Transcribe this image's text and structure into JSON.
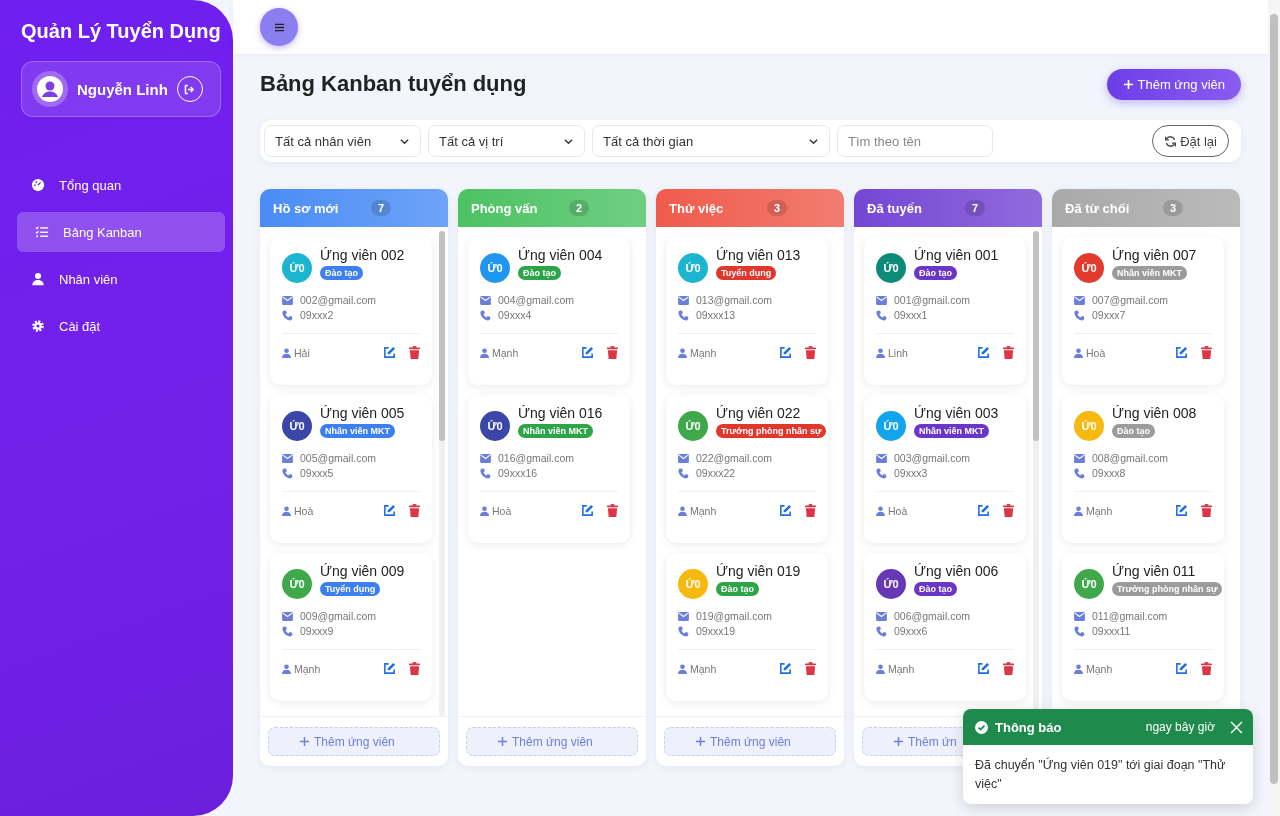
{
  "sidebar": {
    "title": "Quản Lý Tuyển Dụng",
    "user": {
      "name": "Nguyễn Linh"
    },
    "items": [
      {
        "label": "Tổng quan",
        "selected": false
      },
      {
        "label": "Bảng Kanban",
        "selected": true
      },
      {
        "label": "Nhân viên",
        "selected": false
      },
      {
        "label": "Cài đặt",
        "selected": false
      }
    ]
  },
  "page": {
    "title": "Bảng Kanban tuyển dụng",
    "add_button": "Thêm ứng viên"
  },
  "filters": {
    "selects": [
      "Tất cả nhân viên",
      "Tất cả vị trí",
      "Tất cả thời gian"
    ],
    "search": {
      "placeholder": "Tìm theo tên"
    },
    "reset_button": "Đặt lại"
  },
  "columns": [
    {
      "title": "Hồ sơ mới",
      "count": "7",
      "color": "#4a8cf5",
      "add_button": "Thêm ứng viên",
      "scrollbar": true,
      "cards": [
        {
          "avatar": {
            "text": "Ứ0",
            "color": "#1cb5cf"
          },
          "name": "Ứng viên 002",
          "tag": {
            "label": "Đào tạo",
            "color": "#3b7ff0"
          },
          "email": "002@gmail.com",
          "phone": "09xxx2",
          "owner": "Hải"
        },
        {
          "avatar": {
            "text": "Ứ0",
            "color": "#3a46a8"
          },
          "name": "Ứng viên 005",
          "tag": {
            "label": "Nhân viên MKT",
            "color": "#3b7ff0"
          },
          "email": "005@gmail.com",
          "phone": "09xxx5",
          "owner": "Hoà"
        },
        {
          "avatar": {
            "text": "Ứ0",
            "color": "#3ea84a"
          },
          "name": "Ứng viên 009",
          "tag": {
            "label": "Tuyển dụng",
            "color": "#3b7ff0"
          },
          "email": "009@gmail.com",
          "phone": "09xxx9",
          "owner": "Mạnh"
        }
      ]
    },
    {
      "title": "Phỏng vấn",
      "count": "2",
      "color": "#4cc263",
      "add_button": "Thêm ứng viên",
      "scrollbar": false,
      "cards": [
        {
          "avatar": {
            "text": "Ứ0",
            "color": "#2196f0"
          },
          "name": "Ứng viên 004",
          "tag": {
            "label": "Đào tạo",
            "color": "#2ea448"
          },
          "email": "004@gmail.com",
          "phone": "09xxx4",
          "owner": "Mạnh"
        },
        {
          "avatar": {
            "text": "Ứ0",
            "color": "#3a46a8"
          },
          "name": "Ứng viên 016",
          "tag": {
            "label": "Nhân viên MKT",
            "color": "#2ea448"
          },
          "email": "016@gmail.com",
          "phone": "09xxx16",
          "owner": "Hoà"
        }
      ]
    },
    {
      "title": "Thử việc",
      "count": "3",
      "color": "#ef5b4c",
      "add_button": "Thêm ứng viên",
      "scrollbar": false,
      "cards": [
        {
          "avatar": {
            "text": "Ứ0",
            "color": "#1cb5cf"
          },
          "name": "Ứng viên 013",
          "tag": {
            "label": "Tuyển dụng",
            "color": "#e0362c"
          },
          "email": "013@gmail.com",
          "phone": "09xxx13",
          "owner": "Mạnh"
        },
        {
          "avatar": {
            "text": "Ứ0",
            "color": "#3ea84a"
          },
          "name": "Ứng viên 022",
          "tag": {
            "label": "Trưởng phòng nhân sự",
            "color": "#e0362c"
          },
          "email": "022@gmail.com",
          "phone": "09xxx22",
          "owner": "Mạnh"
        },
        {
          "avatar": {
            "text": "Ứ0",
            "color": "#f6b90f"
          },
          "name": "Ứng viên 019",
          "tag": {
            "label": "Đào tạo",
            "color": "#2ea448"
          },
          "email": "019@gmail.com",
          "phone": "09xxx19",
          "owner": "Mạnh"
        }
      ]
    },
    {
      "title": "Đã tuyển",
      "count": "7",
      "color": "#7446d4",
      "add_button": "Thêm ứn",
      "scrollbar": true,
      "cards": [
        {
          "avatar": {
            "text": "Ứ0",
            "color": "#0e8a78"
          },
          "name": "Ứng viên 001",
          "tag": {
            "label": "Đào tạo",
            "color": "#6a35c8"
          },
          "email": "001@gmail.com",
          "phone": "09xxx1",
          "owner": "Linh"
        },
        {
          "avatar": {
            "text": "Ứ0",
            "color": "#12a5ec"
          },
          "name": "Ứng viên 003",
          "tag": {
            "label": "Nhân viên MKT",
            "color": "#6a35c8"
          },
          "email": "003@gmail.com",
          "phone": "09xxx3",
          "owner": "Hoà"
        },
        {
          "avatar": {
            "text": "Ứ0",
            "color": "#6738b5"
          },
          "name": "Ứng viên 006",
          "tag": {
            "label": "Đào tạo",
            "color": "#6a35c8"
          },
          "email": "006@gmail.com",
          "phone": "09xxx6",
          "owner": "Mạnh"
        }
      ]
    },
    {
      "title": "Đã từ chối",
      "count": "3",
      "color": "#a9a9a9",
      "scrollbar": false,
      "cards": [
        {
          "avatar": {
            "text": "Ứ0",
            "color": "#e33a2e"
          },
          "name": "Ứng viên 007",
          "tag": {
            "label": "Nhân viên MKT",
            "color": "#9b9b9b"
          },
          "email": "007@gmail.com",
          "phone": "09xxx7",
          "owner": "Hoà"
        },
        {
          "avatar": {
            "text": "Ứ0",
            "color": "#f6b90f"
          },
          "name": "Ứng viên 008",
          "tag": {
            "label": "Đào tạo",
            "color": "#9b9b9b"
          },
          "email": "008@gmail.com",
          "phone": "09xxx8",
          "owner": "Mạnh"
        },
        {
          "avatar": {
            "text": "Ứ0",
            "color": "#3ea84a"
          },
          "name": "Ứng viên 011",
          "tag": {
            "label": "Trưởng phòng nhân sự",
            "color": "#9b9b9b"
          },
          "email": "011@gmail.com",
          "phone": "09xxx11",
          "owner": "Mạnh"
        }
      ]
    }
  ],
  "toast": {
    "title": "Thông báo",
    "time": "ngay bây giờ",
    "message": "Đã chuyển \"Ứng viên 019\" tới giai đoạn \"Thử việc\""
  }
}
